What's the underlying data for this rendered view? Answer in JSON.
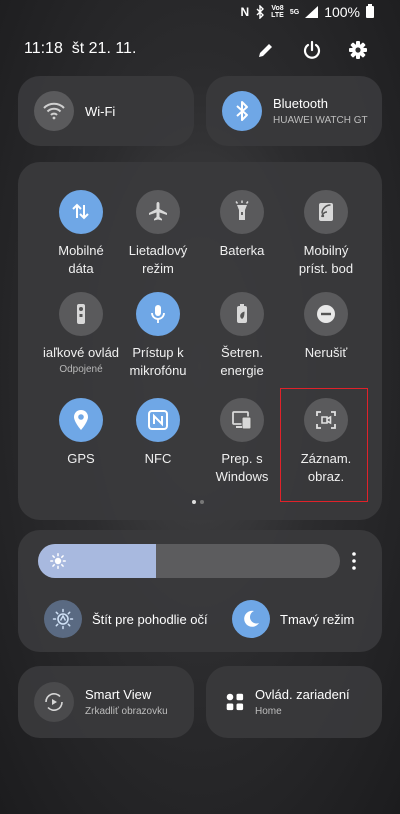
{
  "status": {
    "battery": "100%",
    "signal_label_top": "Vo8",
    "signal_label_bottom": "LTE",
    "network": "5G"
  },
  "header": {
    "time": "11:18",
    "date": "št 21. 11."
  },
  "top_cards": {
    "wifi": {
      "label": "Wi-Fi"
    },
    "bluetooth": {
      "label": "Bluetooth",
      "device": "HUAWEI WATCH GT"
    }
  },
  "tiles": [
    {
      "label": "Mobilné\ndáta",
      "sub": "",
      "state": "on",
      "icon": "mobile-data-icon"
    },
    {
      "label": "Lietadlový\nrežim",
      "sub": "",
      "state": "off",
      "icon": "airplane-icon"
    },
    {
      "label": "Baterka",
      "sub": "",
      "state": "off",
      "icon": "flashlight-icon"
    },
    {
      "label": "Mobilný\npríst. bod",
      "sub": "",
      "state": "off",
      "icon": "hotspot-icon"
    },
    {
      "label": "iaľkové ovlád",
      "sub": "Odpojené",
      "state": "off",
      "icon": "remote-icon"
    },
    {
      "label": "Prístup k\nmikrofónu",
      "sub": "",
      "state": "on",
      "icon": "microphone-icon"
    },
    {
      "label": "Šetren.\nenergie",
      "sub": "",
      "state": "off",
      "icon": "battery-saver-icon"
    },
    {
      "label": "Nerušiť",
      "sub": "",
      "state": "off",
      "icon": "do-not-disturb-icon"
    },
    {
      "label": "GPS",
      "sub": "",
      "state": "on",
      "icon": "location-icon"
    },
    {
      "label": "NFC",
      "sub": "",
      "state": "on",
      "icon": "nfc-icon"
    },
    {
      "label": "Prep. s\nWindows",
      "sub": "",
      "state": "off",
      "icon": "link-windows-icon"
    },
    {
      "label": "Záznam.\nobraz.",
      "sub": "",
      "state": "off",
      "icon": "screen-record-icon"
    }
  ],
  "brightness": {
    "level": 0.39,
    "eye_comfort": "Štít pre pohodlie očí",
    "dark_mode": "Tmavý režim"
  },
  "bottom_cards": {
    "smart_view": {
      "label": "Smart View",
      "sub": "Zrkadliť obrazovku"
    },
    "device_control": {
      "label": "Ovlád. zariadení",
      "sub": "Home"
    }
  },
  "colors": {
    "accent": "#6fa7e6",
    "tile_off": "#5a5a5c",
    "highlight": "#e0222a",
    "slider_fill": "#a8b9df"
  },
  "pagination": {
    "current": 1,
    "total": 2
  }
}
